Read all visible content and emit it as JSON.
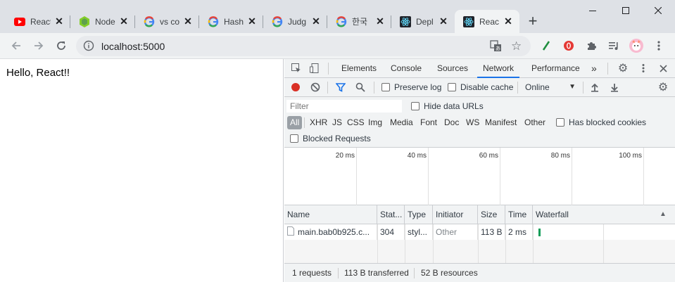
{
  "browser": {
    "tabs": [
      {
        "title": "React",
        "icon": "youtube-icon",
        "active": false
      },
      {
        "title": "Node",
        "icon": "nodejs-icon",
        "active": false
      },
      {
        "title": "vs co",
        "icon": "google-icon",
        "active": false
      },
      {
        "title": "Hash",
        "icon": "google-icon",
        "active": false
      },
      {
        "title": "Judg",
        "icon": "google-icon",
        "active": false
      },
      {
        "title": "한국",
        "icon": "google-icon",
        "active": false
      },
      {
        "title": "Depl",
        "icon": "react-icon",
        "active": false
      },
      {
        "title": "Reac",
        "icon": "react-icon",
        "active": true
      }
    ],
    "new_tab_label": "+",
    "url": "localhost:5000"
  },
  "page": {
    "hello_text": "Hello, React!!"
  },
  "devtools": {
    "tabs": [
      "Elements",
      "Console",
      "Sources",
      "Network",
      "Performance"
    ],
    "more_tabs": "»",
    "active_tab": "Network",
    "toolbar": {
      "preserve_log": "Preserve log",
      "disable_cache": "Disable cache",
      "throttling": "Online"
    },
    "filter": {
      "placeholder": "Filter",
      "hide_data_urls": "Hide data URLs",
      "types": [
        "All",
        "XHR",
        "JS",
        "CSS",
        "Img",
        "Media",
        "Font",
        "Doc",
        "WS",
        "Manifest",
        "Other"
      ],
      "has_blocked_cookies": "Has blocked cookies",
      "blocked_requests": "Blocked Requests"
    },
    "overview_ticks": [
      "20 ms",
      "40 ms",
      "60 ms",
      "80 ms",
      "100 ms"
    ],
    "table": {
      "columns": [
        "Name",
        "Stat...",
        "Type",
        "Initiator",
        "Size",
        "Time",
        "Waterfall"
      ],
      "rows": [
        {
          "name": "main.bab0b925.c...",
          "status": "304",
          "type": "styl...",
          "initiator": "Other",
          "size": "113 B",
          "time": "2 ms"
        }
      ]
    },
    "status": {
      "requests": "1 requests",
      "transferred": "113 B transferred",
      "resources": "52 B resources"
    }
  },
  "colors": {
    "active_tab_underline": "#1a73e8",
    "record_red": "#d93025",
    "filter_blue": "#1a73e8",
    "waterfall_green": "#0f9d58"
  }
}
